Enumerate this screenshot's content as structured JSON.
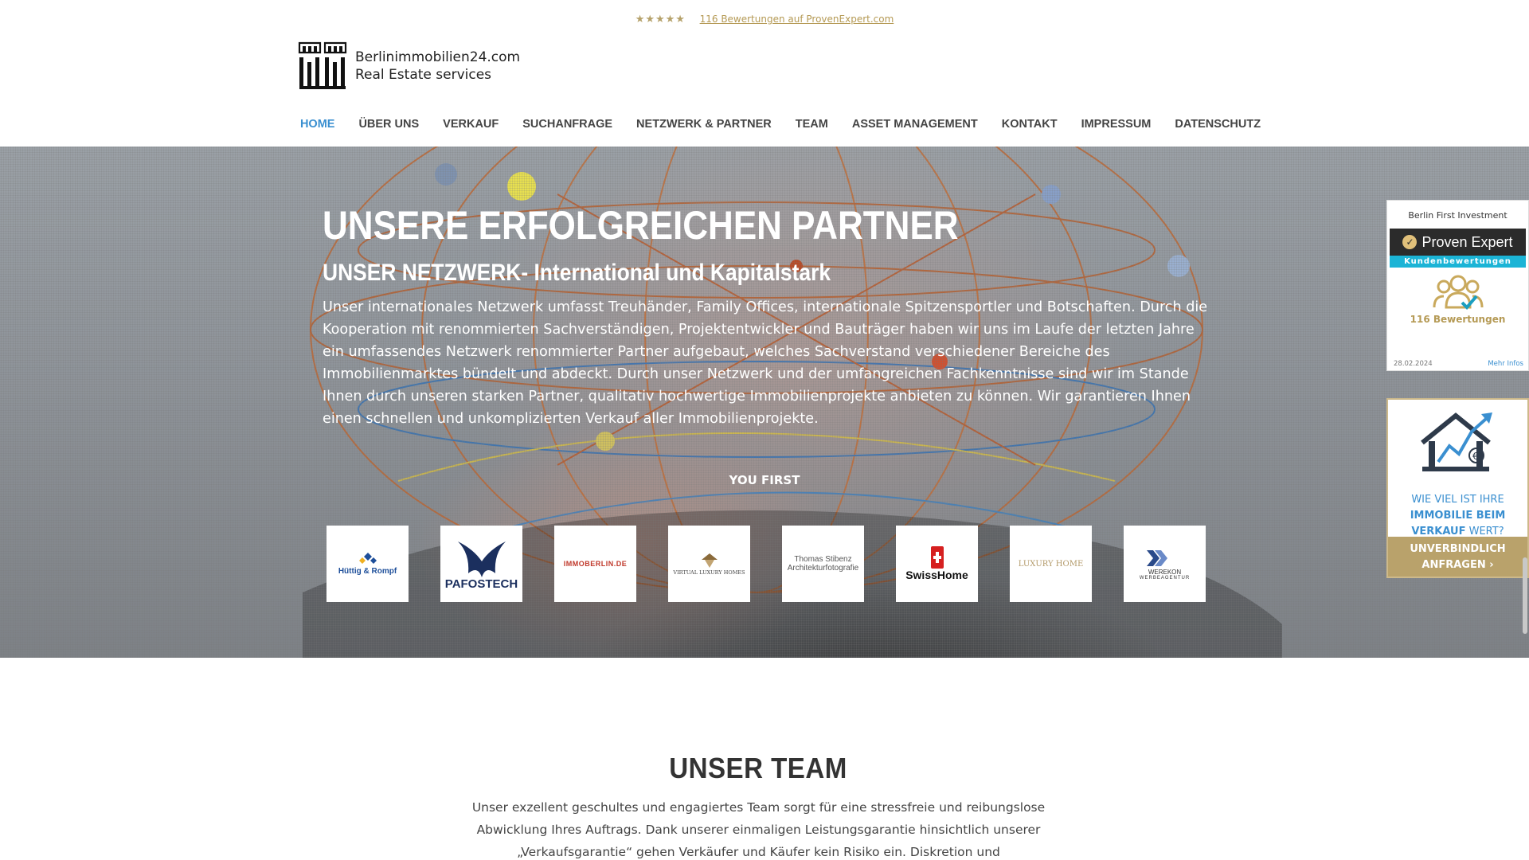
{
  "topbar": {
    "stars": "★★★★★",
    "reviews_link": "116 Bewertungen auf ProvenExpert.com"
  },
  "logo": {
    "line1": "Berlinimmobilien24.com",
    "line2": "Real Estate services",
    "icon": "building-columns-logo"
  },
  "nav": {
    "items": [
      {
        "label": "HOME",
        "active": true
      },
      {
        "label": "ÜBER UNS"
      },
      {
        "label": "VERKAUF"
      },
      {
        "label": "SUCHANFRAGE"
      },
      {
        "label": "NETZWERK & PARTNER"
      },
      {
        "label": "TEAM"
      },
      {
        "label": "ASSET MANAGEMENT"
      },
      {
        "label": "KONTAKT"
      },
      {
        "label": "IMPRESSUM"
      },
      {
        "label": "DATENSCHUTZ"
      }
    ]
  },
  "hero": {
    "title": "UNSERE ERFOLGREICHEN PARTNER",
    "subtitle": "UNSER NETZWERK- International und Kapitalstark",
    "body": "Unser internationales Netzwerk umfasst Treuhänder, Family Offices, internationale Spitzensportler und Botschaften. Durch die Kooperation mit renommierten Sachverständigen, Projektentwickler und Bauträger haben wir uns im Laufe der letzten Jahre ein umfassendes Netzwerk renommierter Partner aufgebaut, welches Sachverstand verschiedener Bereiche des Immobilienmarktes bündelt und abdeckt. Durch unser Netzwerk und der umfangreichen Fachkenntnisse sind wir im Stande Ihnen durch unseren starken Partner, qualitativ hochwertige Immobilienprojekte anbieten zu können. Wir garantieren Ihnen einen schnellen und unkomplizierten Verkauf aller Immobilienprojekte.",
    "you_first": "YOU FIRST"
  },
  "partners": {
    "huettig": "Hüttig & Rompf",
    "pafostech": "PAFOSTECH",
    "immoberlin": "IMMOBERLIN.DE",
    "virtual": "VIRTUAL LUXURY HOMES",
    "thomas_name": "Thomas Stibenz",
    "thomas_sub": "Architekturfotografie",
    "swisshome": "SwissHome",
    "luxury": "LUXURY HOME",
    "werekon_name": "WEREKON",
    "werekon_sub": "WERBEAGENTUR"
  },
  "team": {
    "title": "UNSER TEAM",
    "text": "Unser exzellent geschultes und engagiertes Team sorgt für eine stressfreie und reibungslose Abwicklung Ihres Auftrags. Dank unserer einmaligen Leistungsgarantie hinsichtlich unserer „Verkaufsgarantie“ gehen Verkäufer und Käufer kein Risiko ein. Diskretion und vertrauenswürdiges Handeln sind bei uns ebenso"
  },
  "proven_expert": {
    "company": "Berlin First Investment",
    "brand": "Proven Expert",
    "kunden": "Kundenbewertungen",
    "count": "116 Bewertungen",
    "date": "28.02.2024",
    "more": "Mehr Infos"
  },
  "valuation": {
    "line1": "WIE VIEL IST IHRE",
    "line2": "IMMOBILIE BEIM",
    "line3_bold": "VERKAUF",
    "line3_rest": " WERT?",
    "cta_line1": "UNVERBINDLICH",
    "cta_line2": "ANFRAGEN",
    "cta_arrow": "›"
  },
  "colors": {
    "accent_blue": "#3a8fd0",
    "gold": "#b9a26b",
    "nav_text": "#444444"
  }
}
